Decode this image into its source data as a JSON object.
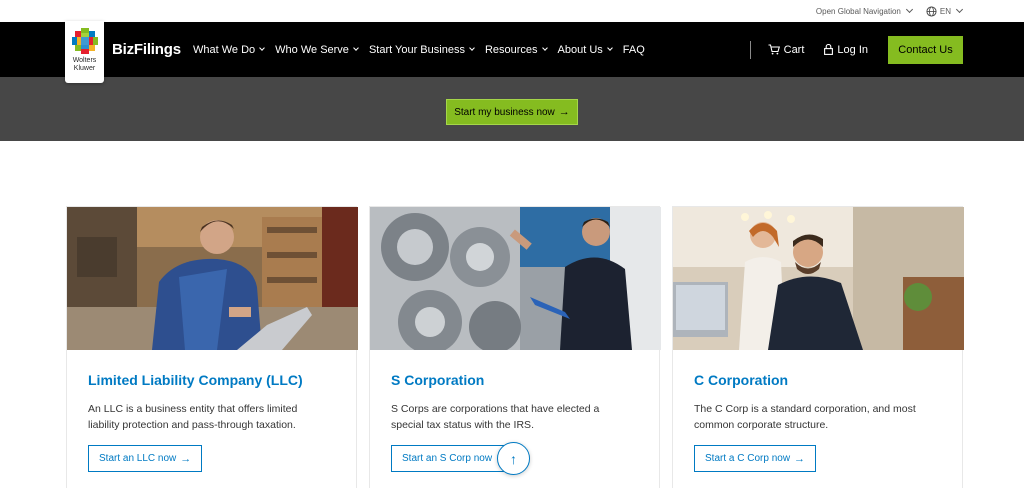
{
  "utility": {
    "global_nav_label": "Open Global Navigation",
    "language": "EN"
  },
  "header": {
    "logo_text_line1": "Wolters",
    "logo_text_line2": "Kluwer",
    "brand": "BizFilings",
    "nav": [
      {
        "label": "What We Do"
      },
      {
        "label": "Who We Serve"
      },
      {
        "label": "Start Your Business"
      },
      {
        "label": "Resources"
      },
      {
        "label": "About Us"
      },
      {
        "label": "FAQ"
      }
    ],
    "cart": "Cart",
    "login": "Log In",
    "contact": "Contact Us"
  },
  "hero": {
    "cta": "Start my business now"
  },
  "cards": [
    {
      "title": "Limited Liability Company (LLC)",
      "desc": "An LLC is a business entity that offers limited liability protection and pass-through taxation.",
      "cta": "Start an LLC now"
    },
    {
      "title": "S Corporation",
      "desc": "S Corps are corporations that have elected a special tax status with the IRS.",
      "cta": "Start an S Corp now"
    },
    {
      "title": "C Corporation",
      "desc": "The C Corp is a standard corporation, and most common corporate structure.",
      "cta": "Start a C Corp now"
    }
  ],
  "colors": {
    "accent_green": "#85bc20",
    "link_blue": "#007ac3",
    "hero_gray": "#474747"
  },
  "icons": {
    "arrow": "→",
    "back_to_top": "↑"
  }
}
